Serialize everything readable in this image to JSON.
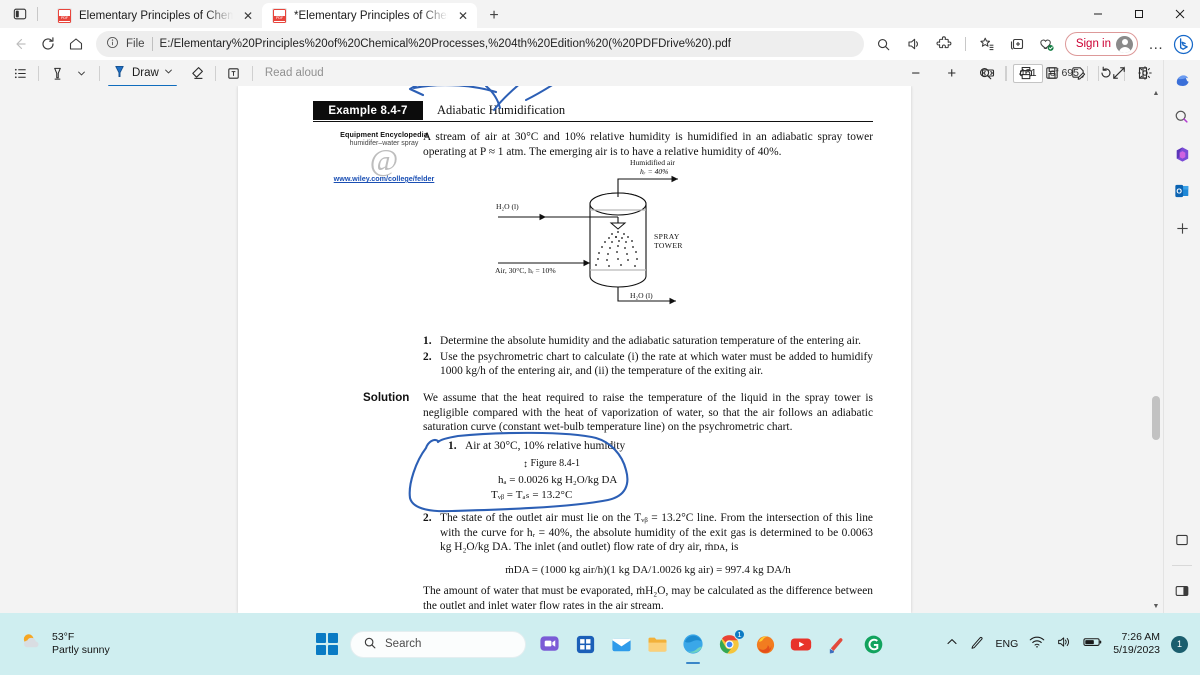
{
  "window": {
    "tab_actions_icon": "tab-actions-icon",
    "minimize_label": "–",
    "maximize_label": "☐",
    "close_label": "✕",
    "tabs": [
      {
        "title": "Elementary Principles of Chemical",
        "favicon": "pdf-file-icon",
        "close": "✕",
        "active": false
      },
      {
        "title": "*Elementary Principles of Chemic",
        "favicon": "pdf-file-icon",
        "close": "✕",
        "active": true
      }
    ],
    "new_tab_label": "+"
  },
  "navbar": {
    "back_icon": "back-arrow-icon",
    "refresh_icon": "refresh-icon",
    "home_icon": "home-icon",
    "info_icon": "info-circle-icon",
    "scheme_label": "File",
    "url": "E:/Elementary%20Principles%20of%20Chemical%20Processes,%204th%20Edition%20(%20PDFDrive%20).pdf",
    "find_icon": "search-icon",
    "readaloud_icon": "read-aloud-icon",
    "extensions_icon": "extensions-puzzle-icon",
    "favorites_icon": "favorites-star-icon",
    "collections_icon": "collections-icon",
    "browser_essentials_icon": "browser-essentials-icon",
    "signin_label": "Sign in",
    "avatar_icon": "profile-avatar-icon",
    "more_label": "…",
    "copilot_icon": "bing-copilot-icon"
  },
  "pdf_toolbar": {
    "contents_icon": "table-of-contents-icon",
    "highlight_icon": "highlighter-icon",
    "highlight_chevron": "chevron-down-icon",
    "draw_icon": "draw-pen-icon",
    "draw_label": "Draw",
    "draw_chevron": "chevron-down-icon",
    "erase_icon": "eraser-icon",
    "text_icon": "add-text-icon",
    "read_aloud_label": "Read aloud",
    "zoom_out_label": "−",
    "zoom_in_label": "+",
    "fit_page_icon": "fit-to-width-icon",
    "page_number": "461",
    "page_total": "of 695",
    "rotate_icon": "rotate-icon",
    "page_view_icon": "page-view-icon",
    "search_icon": "search-icon",
    "print_icon": "print-icon",
    "save_icon": "save-icon",
    "save_as_icon": "save-as-icon",
    "fullscreen_icon": "fullscreen-icon",
    "settings_icon": "settings-gear-icon"
  },
  "document": {
    "example_tag": "Example 8.4-7",
    "example_title": "Adiabatic Humidification",
    "equipment": {
      "line1": "Equipment Encyclopedia",
      "line2": "humidifer–water spray",
      "symbol": "@",
      "url": "www.wiley.com/college/felder"
    },
    "intro": "A stream of air at 30°C and 10% relative humidity is humidified in an adiabatic spray tower operating at P ≈ 1 atm. The emerging air is to have a relative humidity of 40%.",
    "diagram": {
      "top_label_1": "Humidified air",
      "top_label_2": "hᵣ = 40%",
      "water_in": "H₂O (l)",
      "air_in": "Air, 30°C, hᵣ = 10%",
      "tower_label_1": "SPRAY",
      "tower_label_2": "TOWER",
      "water_out": "H₂O (l)"
    },
    "questions": [
      {
        "num": "1.",
        "text": "Determine the absolute humidity and the adiabatic saturation temperature of the entering air."
      },
      {
        "num": "2.",
        "text": "Use the psychrometric chart to calculate (i) the rate at which water must be added to humidify 1000 kg/h of the entering air, and (ii) the temperature of the exiting air."
      }
    ],
    "solution_label": "Solution",
    "solution_text": "We assume that the heat required to raise the temperature of the liquid in the spray tower is negligible compared with the heat of vaporization of water, so that the air follows an adiabatic saturation curve (constant wet-bulb temperature line) on the psychrometric chart.",
    "step1": {
      "num": "1.",
      "text": "Air at 30°C, 10% relative humidity"
    },
    "figure_ref": "Figure 8.4-1",
    "equation_1": "hₐ = 0.0026 kg H₂O/kg DA",
    "equation_2": "Tᵥᵦ = Tₐₛ = 13.2°C",
    "step2": {
      "num": "2.",
      "text": "The state of the outlet air must lie on the Tᵥᵦ = 13.2°C line. From the intersection of this line with the curve for hᵣ = 40%, the absolute humidity of the exit gas is determined to be 0.0063 kg H₂O/kg DA. The inlet (and outlet) flow rate of dry air, ṁᴅᴀ, is"
    },
    "equation_3": "ṁDA = (1000 kg air/h)(1 kg DA/1.0026 kg air) = 997.4 kg DA/h",
    "final_text": "The amount of water that must be evaporated, ṁH₂O, may be calculated as the difference between the outlet and inlet water flow rates in the air stream."
  },
  "sidebar": {
    "items": [
      {
        "icon": "copilot-sidebar-icon",
        "name": "copilot"
      },
      {
        "icon": "search-sidebar-icon",
        "name": "search"
      },
      {
        "icon": "microsoft-365-icon",
        "name": "office"
      },
      {
        "icon": "outlook-icon",
        "name": "outlook"
      },
      {
        "icon": "add-sidebar-icon",
        "name": "add",
        "label": "+"
      }
    ],
    "notes_icon": "notes-icon",
    "customize_icon": "customize-sidebar-icon"
  },
  "taskbar": {
    "weather_temp": "53°F",
    "weather_desc": "Partly sunny",
    "weather_icon": "partly-sunny-icon",
    "start_icon": "windows-start-icon",
    "search_placeholder": "Search",
    "search_icon": "search-icon",
    "apps": [
      {
        "name": "teams-chat",
        "badge": ""
      },
      {
        "name": "microsoft-store",
        "badge": ""
      },
      {
        "name": "mail",
        "badge": ""
      },
      {
        "name": "file-explorer",
        "badge": ""
      },
      {
        "name": "microsoft-edge",
        "badge": ""
      },
      {
        "name": "google-chrome",
        "badge": "1"
      },
      {
        "name": "firefox",
        "badge": ""
      },
      {
        "name": "youtube",
        "badge": ""
      },
      {
        "name": "ccleaner",
        "badge": ""
      },
      {
        "name": "epic-games",
        "badge": ""
      }
    ],
    "tray_chevron": "show-hidden-icons-chevron",
    "pen_icon": "windows-ink-icon",
    "language": "ENG",
    "wifi_icon": "wifi-icon",
    "volume_icon": "volume-icon",
    "battery_icon": "battery-icon",
    "time": "7:26 AM",
    "date": "5/19/2023",
    "notification_count": "1"
  }
}
